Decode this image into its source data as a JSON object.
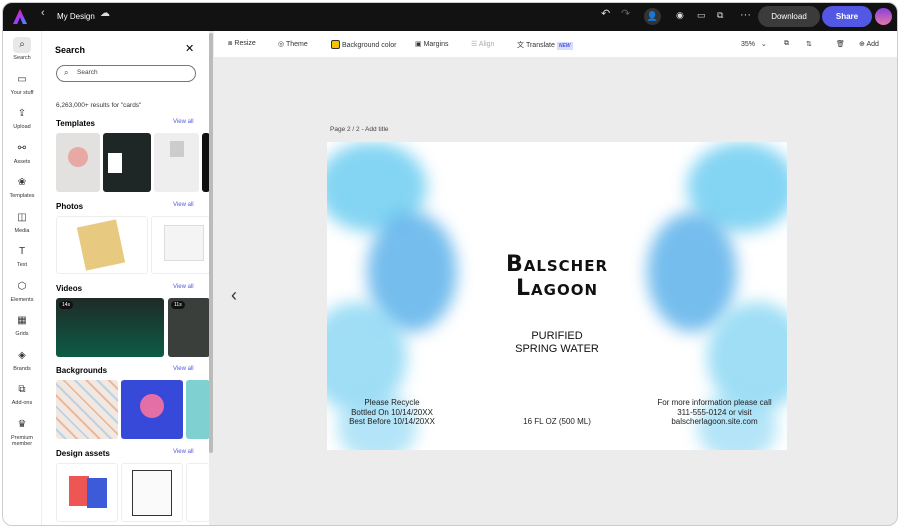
{
  "topbar": {
    "title": "My Design",
    "download": "Download",
    "share": "Share"
  },
  "rail": [
    {
      "label": "Search",
      "icon": "search-icon"
    },
    {
      "label": "Your stuff",
      "icon": "folder-icon"
    },
    {
      "label": "Upload",
      "icon": "upload-icon"
    },
    {
      "label": "Assets",
      "icon": "assets-icon"
    },
    {
      "label": "Templates",
      "icon": "templates-icon"
    },
    {
      "label": "Media",
      "icon": "media-icon"
    },
    {
      "label": "Text",
      "icon": "text-icon"
    },
    {
      "label": "Elements",
      "icon": "elements-icon"
    },
    {
      "label": "Grids",
      "icon": "grids-icon"
    },
    {
      "label": "Brands",
      "icon": "brands-icon"
    },
    {
      "label": "Add-ons",
      "icon": "addons-icon"
    },
    {
      "label": "Premium member",
      "icon": "premium-icon"
    }
  ],
  "panel": {
    "title": "Search",
    "search_placeholder": "Search",
    "results": "6,263,000+ results for \"cards\"",
    "view_all": "View all",
    "sections": [
      "Templates",
      "Photos",
      "Videos",
      "Backgrounds",
      "Design assets"
    ],
    "video_durations": [
      "14s",
      "11s"
    ]
  },
  "toolbar": {
    "resize": "Resize",
    "theme": "Theme",
    "bg": "Background color",
    "margins": "Margins",
    "align": "Align",
    "translate": "Translate",
    "new": "NEW",
    "zoom": "35%",
    "add": "Add"
  },
  "canvas": {
    "page_label": "Page 2 / 2 - Add title",
    "title1": "Balscher",
    "title2": "Lagoon",
    "sub1": "PURIFIED",
    "sub2": "SPRING WATER",
    "left": [
      "Please Recycle",
      "Bottled On 10/14/20XX",
      "Best Before 10/14/20XX"
    ],
    "center": "16 FL OZ (500 ML)",
    "right": [
      "For more information please call",
      "311-555-0124 or visit",
      "balscherlagoon.site.com"
    ]
  },
  "colors": {
    "accent": "#5258e4",
    "topbar": "#121212"
  }
}
